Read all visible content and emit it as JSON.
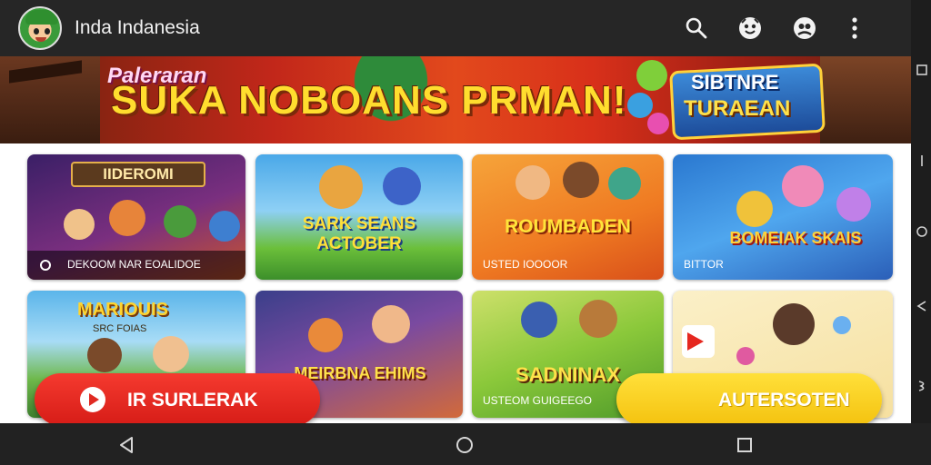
{
  "app": {
    "title": "Inda Indanesia"
  },
  "colors": {
    "appbar": "#262626",
    "red_button": "#e5271f",
    "yellow_button": "#f8cf1f",
    "nav": "#222222"
  },
  "toolbar": {
    "icons": [
      "search-icon",
      "face-icon",
      "account-icon",
      "more-vert-icon"
    ]
  },
  "banner": {
    "small_text": "Paleraran",
    "main_text": "SUKA NOBOANS PRMAN!",
    "badge_line1": "SIBTNRE",
    "badge_line2": "TURAEAN"
  },
  "cards": [
    {
      "title": "IIDEROMI",
      "subtitle": "DEKOOM NAR EOALIDOE"
    },
    {
      "title": "SARK SEANS ACTOBER",
      "subtitle": ""
    },
    {
      "title": "ROUMBADEN",
      "subtitle": "USTED IOOOOR"
    },
    {
      "title": "BOMEIAK SKAIS",
      "subtitle": "BITTOR"
    },
    {
      "title": "MARIOUIS",
      "subtitle": "SRC FOIAS"
    },
    {
      "title": "MEIRBNA EHIMS",
      "subtitle": ""
    },
    {
      "title": "SADNINAX",
      "subtitle": "USTEOM GUIGEEGO"
    },
    {
      "title": "",
      "subtitle": ""
    }
  ],
  "buttons": {
    "primary_label": "IR SURLERAK",
    "secondary_label": "AUTERSOTEN"
  },
  "navigation": [
    "back-icon",
    "home-icon",
    "recents-icon"
  ]
}
